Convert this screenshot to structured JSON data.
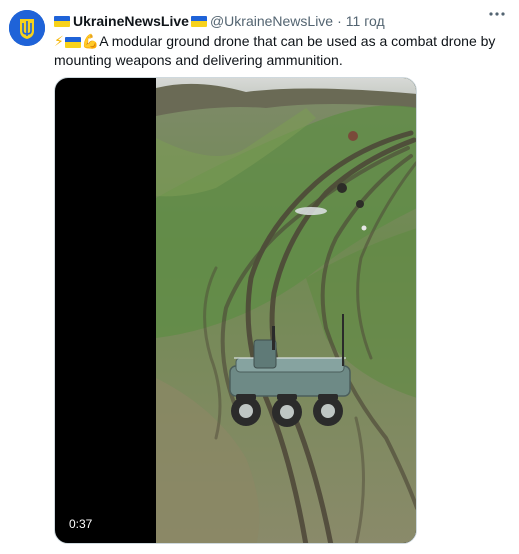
{
  "author": {
    "name": "UkraineNewsLive",
    "handle": "@UkraineNewsLive",
    "time": "11 год"
  },
  "tweet": {
    "text": "A modular ground drone that can be used as a combat drone by mounting weapons and delivering ammunition."
  },
  "video": {
    "duration": "0:37"
  },
  "icons": {
    "avatar": "coat-of-arms-icon",
    "more": "more-options-icon",
    "flag": "ukraine-flag-icon",
    "bolt": "lightning-icon",
    "flex": "flexed-biceps-icon"
  },
  "colors": {
    "flag_blue": "#1f63d8",
    "flag_yellow": "#f7d21b",
    "secondary_text": "#536471"
  }
}
